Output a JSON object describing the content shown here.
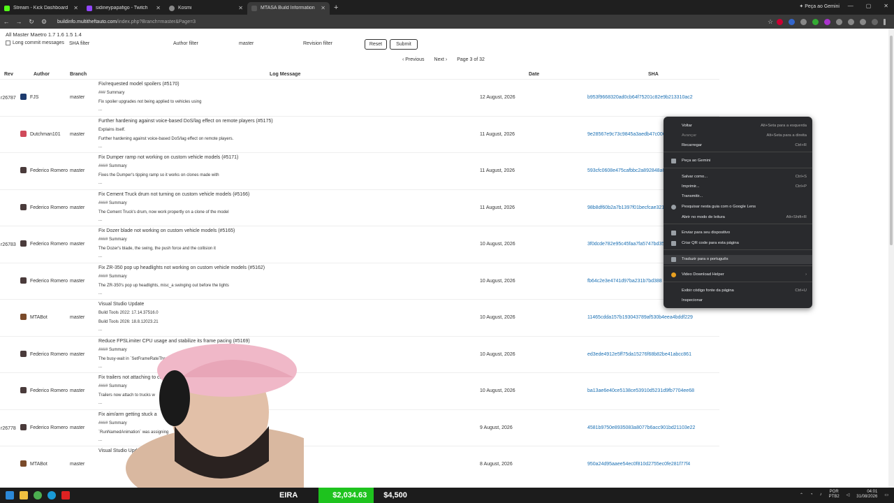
{
  "browser": {
    "tabs": [
      {
        "title": "Stream - Kick Dashboard",
        "color": "#53fc18",
        "active": false
      },
      {
        "title": "sidineypapafigo - Twitch",
        "color": "#9146ff",
        "active": false
      },
      {
        "title": "Kosmi",
        "color": "#888888",
        "active": false
      },
      {
        "title": "MTASA Build Information",
        "color": "#555555",
        "active": true
      }
    ],
    "gemini_label": "Peça ao Gemini",
    "url_host": "buildinfo.multitheftauto.com",
    "url_path": "/index.php?Branch=master&Page=3"
  },
  "page": {
    "versions": "All Master Maetro 1.7 1.6 1.5 1.4",
    "long_commit_label": "Long commit messages",
    "sha_filter_label": "SHA filter",
    "author_filter_label": "Author filter",
    "branch_value": "master",
    "revision_filter_label": "Revision filter",
    "reset_label": "Reset",
    "submit_label": "Submit",
    "previous_label": "Previous",
    "next_label": "Next",
    "page_info": "Page 3 of 32",
    "headers": {
      "rev": "Rev",
      "author": "Author",
      "branch": "Branch",
      "log": "Log Message",
      "date": "Date",
      "sha": "SHA"
    },
    "rows": [
      {
        "rev": "r26787",
        "author": "FJS",
        "branch": "master",
        "title": "Fix/requested model spoilers (#5170)",
        "l2": "### Summary",
        "l3": "Fix spoiler upgrades not being applied to vehicles using",
        "l4": "...",
        "date": "12 August, 2026",
        "sha": "b953f9668320ad0cb64f75201c82e9b213310ac2",
        "avatar": "#1d3b6e"
      },
      {
        "rev": "",
        "author": "Dutchman101",
        "branch": "master",
        "title": "Further hardening against voice-based DoS/lag effect on remote players (#5175)",
        "l2": "Explains itself.",
        "l3": "Further hardening against voice-based DoS/lag effect on remote players.",
        "l4": "...",
        "date": "11 August, 2026",
        "sha": "9e28567e9c73c9845a3aedb47c0063",
        "avatar": "#d04a5a"
      },
      {
        "rev": "",
        "author": "Federico Romero",
        "branch": "master",
        "title": "Fix Dumper ramp not working on custom vehicle models (#5171)",
        "l2": "#### Summary",
        "l3": "Fixes the Dumper's tipping ramp so it works on clones made with",
        "l4": "...",
        "date": "11 August, 2026",
        "sha": "593cfc0608e475cafbbc2a892848a6",
        "avatar": "#4a3b3b"
      },
      {
        "rev": "",
        "author": "Federico Romero",
        "branch": "master",
        "title": "Fix Cement Truck drum not turning on custom vehicle models (#5166)",
        "l2": "#### Summary",
        "l3": "The Cement Truck's drum, now work propertly on a clone of the model",
        "l4": "...",
        "date": "11 August, 2026",
        "sha": "98b8df60b2a7b1397f01becfcae321",
        "avatar": "#4a3b3b"
      },
      {
        "rev": "r26783",
        "author": "Federico Romero",
        "branch": "master",
        "title": "Fix Dozer blade not working on custom vehicle models (#5165)",
        "l2": "#### Summary",
        "l3": "The Dozer's blade, the swing, the push force and the collision it",
        "l4": "...",
        "date": "10 August, 2026",
        "sha": "3f0dcde782e95c45faa7fa5747bd35",
        "avatar": "#4a3b3b"
      },
      {
        "rev": "",
        "author": "Federico Romero",
        "branch": "master",
        "title": "Fix ZR-350 pop up headlights not working on custom vehicle models (#5162)",
        "l2": "#### Summary",
        "l3": "The ZR-350's pop up headlights, misc_a swinging out before the lights",
        "l4": "...",
        "date": "10 August, 2026",
        "sha": "fb64c2e3e4741d97ba231b7bd388",
        "avatar": "#4a3b3b"
      },
      {
        "rev": "",
        "author": "MTABot",
        "branch": "master",
        "title": "Visual Studio Update",
        "l2": "Build Tools 2022: 17.14.37516.0",
        "l3": "Build Tools 2026: 18.8.12023.21",
        "l4": "...",
        "date": "10 August, 2026",
        "sha": "11465cdda157b193043789af530b4eea4bddf229",
        "avatar": "#7a4a2a"
      },
      {
        "rev": "",
        "author": "Federico Romero",
        "branch": "master",
        "title": "Reduce FPSLimiter CPU usage and stabilize its frame pacing (#5169)",
        "l2": "#### Summary",
        "l3": "The busy-wait in `SetFrameRateThrottle` us",
        "l4": "...",
        "date": "10 August, 2026",
        "sha": "ed3ede4912e5ff75da15276f68b82be41abcc861",
        "avatar": "#4a3b3b"
      },
      {
        "rev": "",
        "author": "Federico Romero",
        "branch": "master",
        "title": "Fix trailers not attaching to cust",
        "l2": "#### Summary",
        "l3": "Trailers now attach to trucks w",
        "l4": "...",
        "date": "10 August, 2026",
        "sha": "ba13ae6e40ce5138ce53910d5231d9fb7704ee68",
        "avatar": "#4a3b3b"
      },
      {
        "rev": "r26778",
        "author": "Federico Romero",
        "branch": "master",
        "title": "Fix aim/arm getting stuck a",
        "l2": "#### Summary",
        "l3": "`RunNamedAnimation` was assigning",
        "l4": "...",
        "date": "9 August, 2026",
        "sha": "4581b9750e8935083a8077b6acc901bd21103e22",
        "avatar": "#4a3b3b"
      },
      {
        "rev": "",
        "author": "MTABot",
        "branch": "master",
        "title": "Visual Studio Upda",
        "l2": "",
        "l3": "",
        "l4": "",
        "date": "8 August, 2026",
        "sha": "950a24d95aaee54ec0f810d2755ec0fe281f77f4",
        "avatar": "#7a4a2a"
      }
    ]
  },
  "context_menu": {
    "items": [
      {
        "label": "Voltar",
        "shortcut": "Alt+Seta para a esquerda",
        "disabled": false
      },
      {
        "label": "Avançar",
        "shortcut": "Alt+Seta para a direita",
        "disabled": true
      },
      {
        "label": "Recarregar",
        "shortcut": "Ctrl+R",
        "disabled": false
      },
      {
        "label": "Peça ao Gemini",
        "shortcut": "",
        "disabled": false
      },
      {
        "label": "Salvar como...",
        "shortcut": "Ctrl+S",
        "disabled": false
      },
      {
        "label": "Imprimir...",
        "shortcut": "Ctrl+P",
        "disabled": false
      },
      {
        "label": "Transmitir...",
        "shortcut": "",
        "disabled": false
      },
      {
        "label": "Pesquisar nesta guia com o Google Lens",
        "shortcut": "",
        "disabled": false
      },
      {
        "label": "Abrir no modo de leitura",
        "shortcut": "Alt+Shift+R",
        "disabled": false
      },
      {
        "label": "Enviar para seu dispositivo",
        "shortcut": "",
        "disabled": false
      },
      {
        "label": "Criar QR code para esta página",
        "shortcut": "",
        "disabled": false
      },
      {
        "label": "Traduzir para o português",
        "shortcut": "",
        "disabled": false
      },
      {
        "label": "Video Download Helper",
        "shortcut": "›",
        "disabled": false
      },
      {
        "label": "Exibir código fonte da página",
        "shortcut": "Ctrl+U",
        "disabled": false
      },
      {
        "label": "Inspecionar",
        "shortcut": "",
        "disabled": false
      }
    ]
  },
  "overlay": {
    "ticker_left": "EIRA",
    "ticker_green": "$2,034.63",
    "ticker_right": "$4,500"
  },
  "tray": {
    "lang": "POR",
    "lang2": "PTB2",
    "time": "04:01",
    "date": "31/08/2026"
  }
}
